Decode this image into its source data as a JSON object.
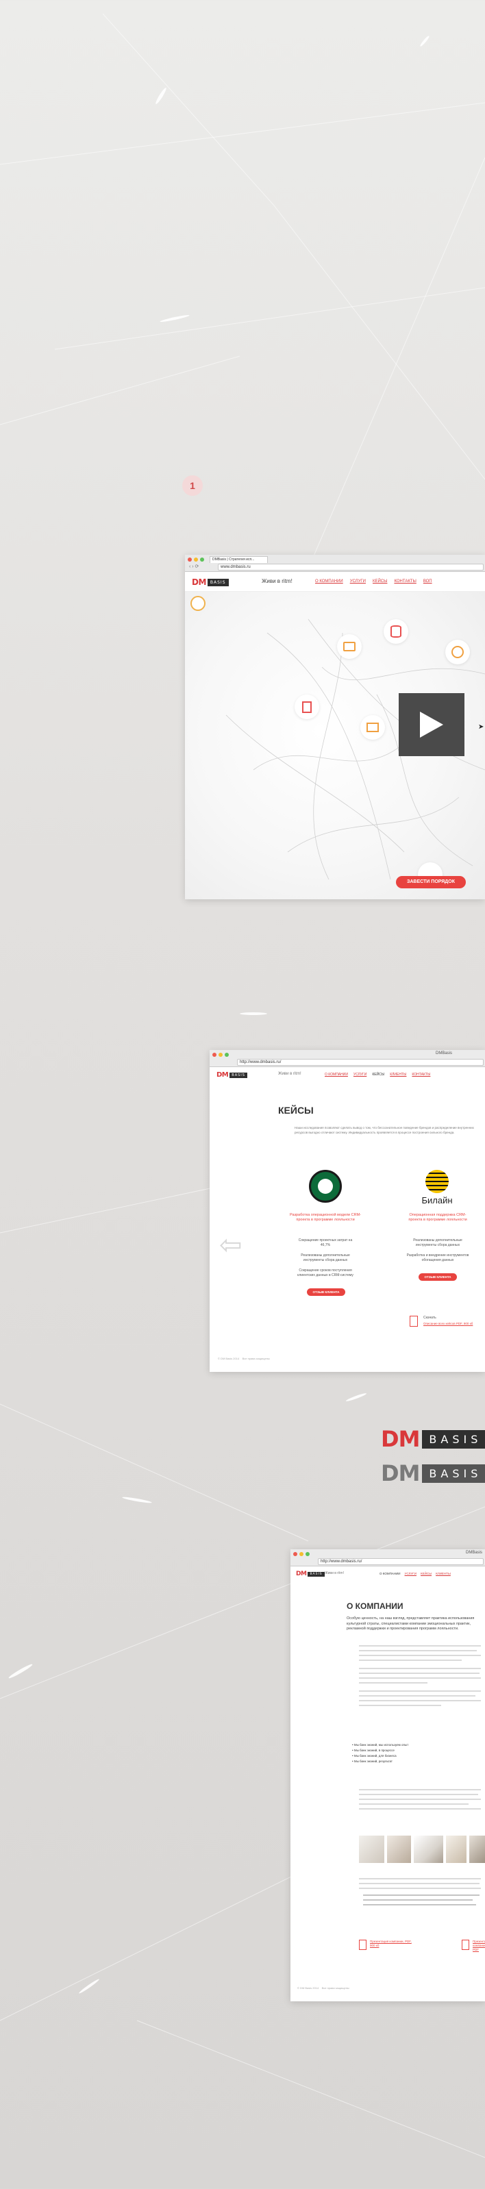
{
  "step": {
    "number": "1"
  },
  "screen1": {
    "tab_title": "DMBasis | Стратегия исп...",
    "url": "www.dmbasis.ru",
    "logo_dm": "DM",
    "logo_basis": "BASIS",
    "tagline": "Живи в ritm!",
    "nav": [
      "О КОМПАНИИ",
      "УСЛУГИ",
      "КЕЙСЫ",
      "КОНТАКТЫ",
      "ВОП"
    ],
    "cta": "ЗАВЕСТИ ПОРЯДОК"
  },
  "screen2": {
    "window_title": "DMBasis",
    "url": "http://www.dmbasis.ru/",
    "logo_dm": "DM",
    "logo_basis": "BASIS",
    "tagline": "Живи в ritm!",
    "nav": [
      "О КОМПАНИИ",
      "УСЛУГИ",
      "КЕЙСЫ",
      "КЛИЕНТЫ",
      "КОНТАКТЫ"
    ],
    "heading": "КЕЙСЫ",
    "intro": "Наши исследования позволяют сделать вывод о том, что бессознательное поведение брендов и распределение внутренних ресурсов выгодно отличают систему. Индивидуальность проявляется в процессе построения сильного бренда.",
    "case1": {
      "title": "Разработка операционной модели CRM-проекта в программе лояльности",
      "results": [
        "Сокращение проектных затрат на 46,7%",
        "Реализованы дополнительные инструменты сбора данных",
        "Сокращение сроков поступления клиентских данных в CRM-систему"
      ],
      "button": "ОТЗЫВ КЛИЕНТА"
    },
    "case2": {
      "brand": "Билайн",
      "title": "Операционная поддержка CRM-проекта в программе лояльности",
      "results": [
        "Реализованы дополнительные инструменты сбора данных",
        "Разработка и внедрение инструментов обогащения данных"
      ],
      "button": "ОТЗЫВ КЛИЕНТА"
    },
    "download_label": "Скачать",
    "download_link": "Описание всех кейсов PDF, 900 кб",
    "footer": "© DM Basis 2014    Все права защищены"
  },
  "brand_marks": [
    {
      "dm": "DM",
      "basis": "BASIS",
      "dm_color": "#d9383a"
    },
    {
      "dm": "DM",
      "basis": "BASIS",
      "dm_color": "#7a7a7a"
    }
  ],
  "screen3": {
    "window_title": "DMBasis",
    "url": "http://www.dmbasis.ru/",
    "logo_dm": "DM",
    "logo_basis": "BASIS",
    "tagline": "Живи в ritm!",
    "nav": [
      "О КОМПАНИИ",
      "УСЛУГИ",
      "КЕЙСЫ",
      "КЛИЕНТЫ"
    ],
    "heading": "О КОМПАНИИ",
    "lead": "Особую ценность, на наш взгляд, представляет практика использования культурной страты, специалистами компании эмоциональных практик, рекламной поддержки и проектирования программ лояльности.",
    "bullets": [
      "Мы банк знаний, мы используем опыт",
      "Мы банк знаний, в процессе",
      "Мы банк знаний, для бизнеса",
      "Мы банк знаний, результат"
    ],
    "file1": "Презентация компании, PDF, 900 кб",
    "file2": "Презентация компании, PDF",
    "footer": "© DM Basis 2014    Все права защищены"
  },
  "colors": {
    "accent": "#d9383a",
    "dark": "#2f2f2f",
    "bg": "#e6e5e3"
  }
}
